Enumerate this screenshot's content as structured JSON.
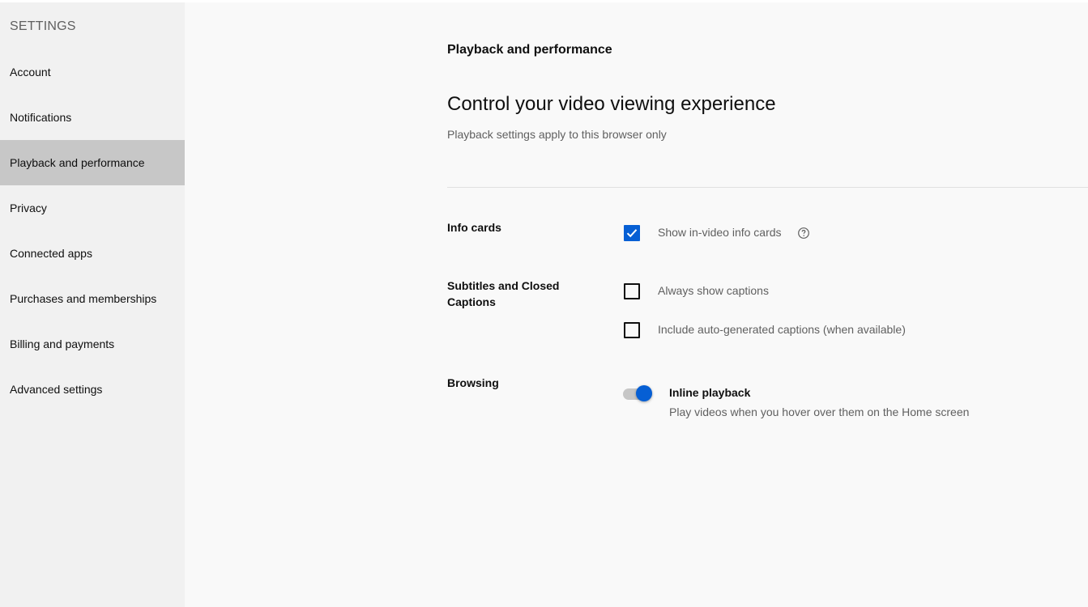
{
  "sidebar": {
    "heading": "SETTINGS",
    "items": [
      {
        "label": "Account"
      },
      {
        "label": "Notifications"
      },
      {
        "label": "Playback and performance",
        "active": true
      },
      {
        "label": "Privacy"
      },
      {
        "label": "Connected apps"
      },
      {
        "label": "Purchases and memberships"
      },
      {
        "label": "Billing and payments"
      },
      {
        "label": "Advanced settings"
      }
    ]
  },
  "main": {
    "section_title": "Playback and performance",
    "heading": "Control your video viewing experience",
    "subtitle": "Playback settings apply to this browser only",
    "info_cards": {
      "label": "Info cards",
      "option": {
        "label": "Show in-video info cards",
        "checked": true
      },
      "help_icon": "help-circle-icon"
    },
    "captions": {
      "label": "Subtitles and Closed Captions",
      "options": [
        {
          "label": "Always show captions",
          "checked": false
        },
        {
          "label": "Include auto-generated captions (when available)",
          "checked": false
        }
      ]
    },
    "browsing": {
      "label": "Browsing",
      "toggle": {
        "title": "Inline playback",
        "description": "Play videos when you hover over them on the Home screen",
        "on": true
      }
    }
  },
  "colors": {
    "accent": "#065fd4",
    "sidebar_bg": "#f1f1f1",
    "active_item_bg": "#c7c7c7",
    "page_bg": "#f9f9f9"
  }
}
